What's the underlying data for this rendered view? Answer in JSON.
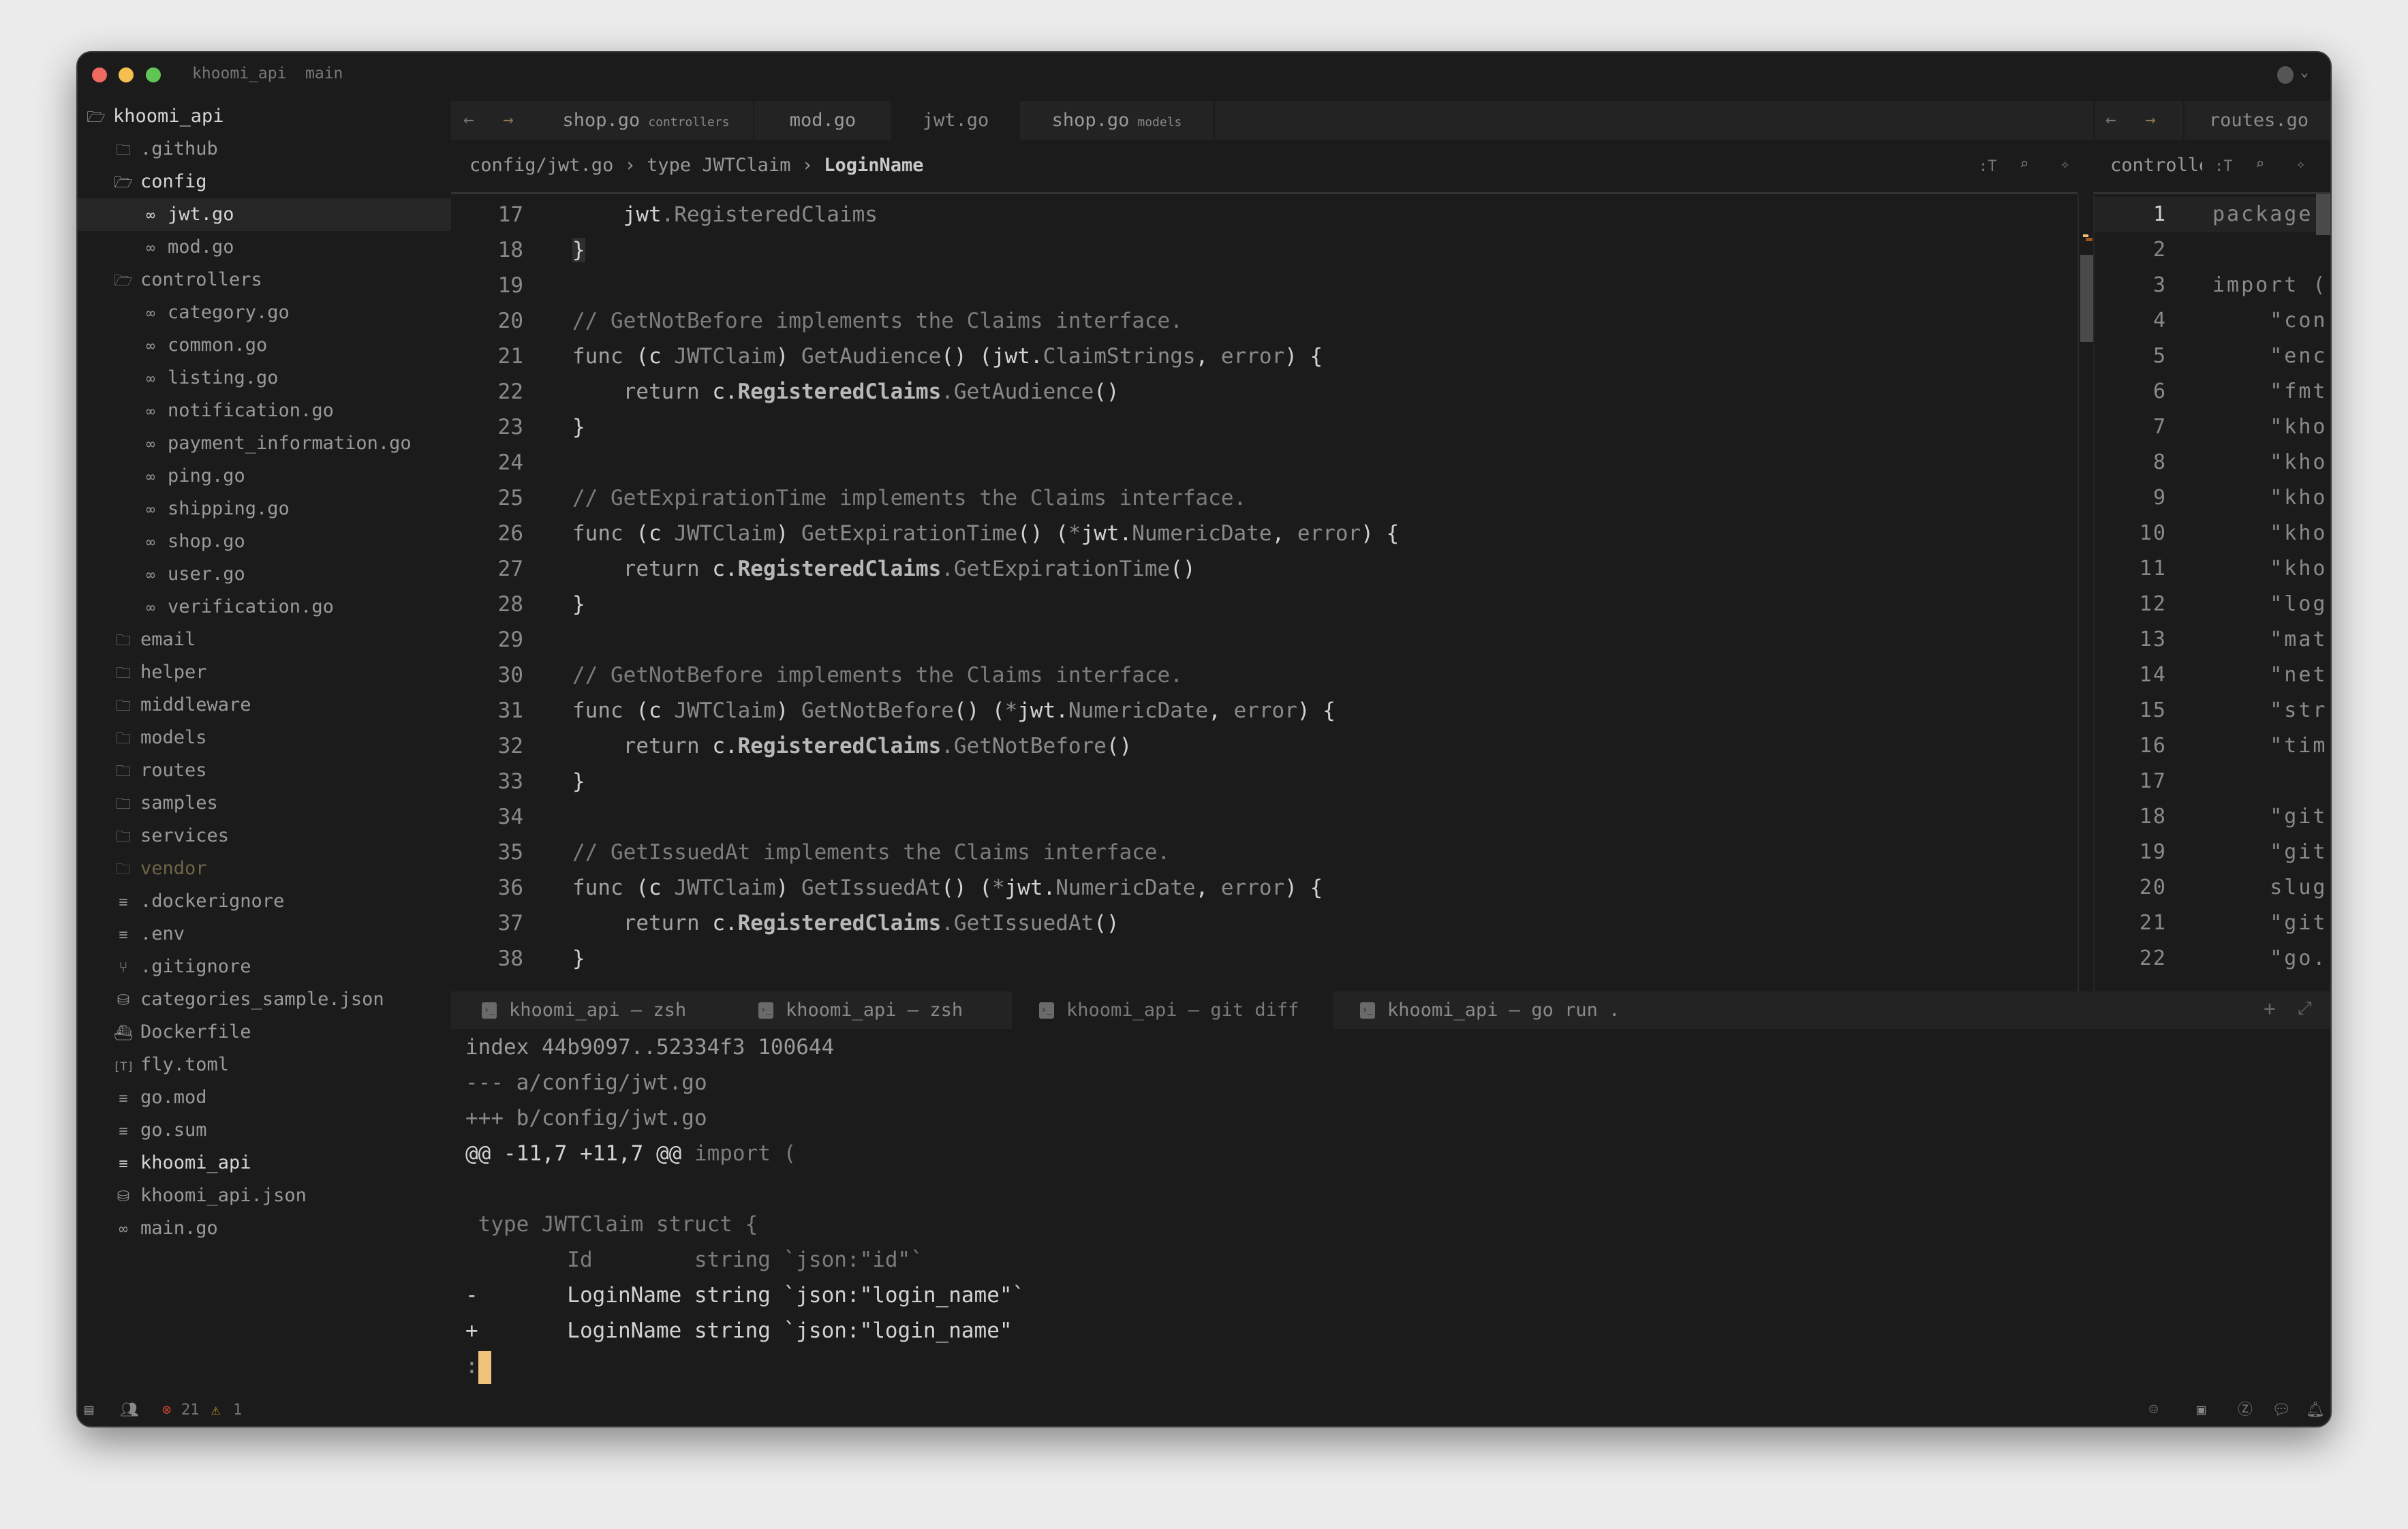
{
  "window": {
    "project": "khoomi_api",
    "branch": "main"
  },
  "colors": {
    "close": "#ed6a5e",
    "minimize": "#f5bf4f",
    "maximize": "#61c554",
    "cursor": "#f0c27b",
    "error": "#c4432f",
    "warning": "#c9962c",
    "vendor": "#6e6548"
  },
  "sidebar": {
    "items": [
      {
        "label": "khoomi_api",
        "icon": "folder-open-icon",
        "level": 0,
        "bright": true
      },
      {
        "label": ".github",
        "icon": "folder-icon",
        "level": 1
      },
      {
        "label": "config",
        "icon": "folder-open-icon",
        "level": 1,
        "bright": true
      },
      {
        "label": "jwt.go",
        "icon": "go-file-icon",
        "level": 2,
        "selected": true,
        "bright": true
      },
      {
        "label": "mod.go",
        "icon": "go-file-icon",
        "level": 2
      },
      {
        "label": "controllers",
        "icon": "folder-open-icon",
        "level": 1
      },
      {
        "label": "category.go",
        "icon": "go-file-icon",
        "level": 2
      },
      {
        "label": "common.go",
        "icon": "go-file-icon",
        "level": 2
      },
      {
        "label": "listing.go",
        "icon": "go-file-icon",
        "level": 2
      },
      {
        "label": "notification.go",
        "icon": "go-file-icon",
        "level": 2
      },
      {
        "label": "payment_information.go",
        "icon": "go-file-icon",
        "level": 2
      },
      {
        "label": "ping.go",
        "icon": "go-file-icon",
        "level": 2
      },
      {
        "label": "shipping.go",
        "icon": "go-file-icon",
        "level": 2
      },
      {
        "label": "shop.go",
        "icon": "go-file-icon",
        "level": 2
      },
      {
        "label": "user.go",
        "icon": "go-file-icon",
        "level": 2
      },
      {
        "label": "verification.go",
        "icon": "go-file-icon",
        "level": 2
      },
      {
        "label": "email",
        "icon": "folder-icon",
        "level": 1
      },
      {
        "label": "helper",
        "icon": "folder-icon",
        "level": 1
      },
      {
        "label": "middleware",
        "icon": "folder-icon",
        "level": 1
      },
      {
        "label": "models",
        "icon": "folder-icon",
        "level": 1
      },
      {
        "label": "routes",
        "icon": "folder-icon",
        "level": 1
      },
      {
        "label": "samples",
        "icon": "folder-icon",
        "level": 1
      },
      {
        "label": "services",
        "icon": "folder-icon",
        "level": 1
      },
      {
        "label": "vendor",
        "icon": "folder-icon",
        "level": 1,
        "ignored": true
      },
      {
        "label": ".dockerignore",
        "icon": "text-file-icon",
        "level": 1
      },
      {
        "label": ".env",
        "icon": "text-file-icon",
        "level": 1
      },
      {
        "label": ".gitignore",
        "icon": "git-icon",
        "level": 1
      },
      {
        "label": "categories_sample.json",
        "icon": "database-icon",
        "level": 1
      },
      {
        "label": "Dockerfile",
        "icon": "docker-icon",
        "level": 1
      },
      {
        "label": "fly.toml",
        "icon": "toml-icon",
        "level": 1
      },
      {
        "label": "go.mod",
        "icon": "text-file-icon",
        "level": 1
      },
      {
        "label": "go.sum",
        "icon": "text-file-icon",
        "level": 1
      },
      {
        "label": "khoomi_api",
        "icon": "text-file-icon",
        "level": 1,
        "bright": true
      },
      {
        "label": "khoomi_api.json",
        "icon": "database-icon",
        "level": 1
      },
      {
        "label": "main.go",
        "icon": "go-file-icon",
        "level": 1
      }
    ]
  },
  "editor": {
    "tabs": [
      {
        "label": "shop.go",
        "detail": "controllers"
      },
      {
        "label": "mod.go",
        "detail": ""
      },
      {
        "label": "jwt.go",
        "detail": "",
        "active": true
      },
      {
        "label": "shop.go",
        "detail": "models"
      }
    ],
    "breadcrumb": {
      "file": "config/jwt.go",
      "sep1": "›",
      "type": "type JWTClaim",
      "sep2": "›",
      "symbol": "LoginName"
    },
    "lines": [
      {
        "n": "17",
        "t": [
          [
            "    ",
            ""
          ],
          [
            "jwt",
            "fg"
          ],
          [
            ".RegisteredClaims",
            "dim"
          ]
        ]
      },
      {
        "n": "18",
        "t": [
          [
            "}",
            "fg br"
          ]
        ]
      },
      {
        "n": "19",
        "t": []
      },
      {
        "n": "20",
        "t": [
          [
            "// GetNotBefore implements the Claims interface.",
            "cm"
          ]
        ]
      },
      {
        "n": "21",
        "t": [
          [
            "func ",
            "kw"
          ],
          [
            "(c ",
            "fg"
          ],
          [
            "JWTClaim",
            "dim"
          ],
          [
            ") ",
            "fg"
          ],
          [
            "GetAudience",
            "dim"
          ],
          [
            "() (",
            "fg"
          ],
          [
            "jwt.",
            "fg"
          ],
          [
            "ClaimStrings",
            "dim"
          ],
          [
            ", ",
            "fg"
          ],
          [
            "error",
            "dim"
          ],
          [
            ") {",
            "fg"
          ]
        ]
      },
      {
        "n": "22",
        "t": [
          [
            "    return ",
            "kw"
          ],
          [
            "c.",
            "fg"
          ],
          [
            "RegisteredClaims",
            "bd"
          ],
          [
            ".GetAudience",
            "dim"
          ],
          [
            "()",
            "fg"
          ]
        ]
      },
      {
        "n": "23",
        "t": [
          [
            "}",
            "fg"
          ]
        ]
      },
      {
        "n": "24",
        "t": []
      },
      {
        "n": "25",
        "t": [
          [
            "// GetExpirationTime implements the Claims interface.",
            "cm"
          ]
        ]
      },
      {
        "n": "26",
        "t": [
          [
            "func ",
            "kw"
          ],
          [
            "(c ",
            "fg"
          ],
          [
            "JWTClaim",
            "dim"
          ],
          [
            ") ",
            "fg"
          ],
          [
            "GetExpirationTime",
            "dim"
          ],
          [
            "() (",
            "fg"
          ],
          [
            "*",
            "dim"
          ],
          [
            "jwt.",
            "fg"
          ],
          [
            "NumericDate",
            "dim"
          ],
          [
            ", ",
            "fg"
          ],
          [
            "error",
            "dim"
          ],
          [
            ") {",
            "fg"
          ]
        ]
      },
      {
        "n": "27",
        "t": [
          [
            "    return ",
            "kw"
          ],
          [
            "c.",
            "fg"
          ],
          [
            "RegisteredClaims",
            "bd"
          ],
          [
            ".GetExpirationTime",
            "dim"
          ],
          [
            "()",
            "fg"
          ]
        ]
      },
      {
        "n": "28",
        "t": [
          [
            "}",
            "fg"
          ]
        ]
      },
      {
        "n": "29",
        "t": []
      },
      {
        "n": "30",
        "t": [
          [
            "// GetNotBefore implements the Claims interface.",
            "cm"
          ]
        ]
      },
      {
        "n": "31",
        "t": [
          [
            "func ",
            "kw"
          ],
          [
            "(c ",
            "fg"
          ],
          [
            "JWTClaim",
            "dim"
          ],
          [
            ") ",
            "fg"
          ],
          [
            "GetNotBefore",
            "dim"
          ],
          [
            "() (",
            "fg"
          ],
          [
            "*",
            "dim"
          ],
          [
            "jwt.",
            "fg"
          ],
          [
            "NumericDate",
            "dim"
          ],
          [
            ", ",
            "fg"
          ],
          [
            "error",
            "dim"
          ],
          [
            ") {",
            "fg"
          ]
        ]
      },
      {
        "n": "32",
        "t": [
          [
            "    return ",
            "kw"
          ],
          [
            "c.",
            "fg"
          ],
          [
            "RegisteredClaims",
            "bd"
          ],
          [
            ".GetNotBefore",
            "dim"
          ],
          [
            "()",
            "fg"
          ]
        ]
      },
      {
        "n": "33",
        "t": [
          [
            "}",
            "fg"
          ]
        ]
      },
      {
        "n": "34",
        "t": []
      },
      {
        "n": "35",
        "t": [
          [
            "// GetIssuedAt implements the Claims interface.",
            "cm"
          ]
        ]
      },
      {
        "n": "36",
        "t": [
          [
            "func ",
            "kw"
          ],
          [
            "(c ",
            "fg"
          ],
          [
            "JWTClaim",
            "dim"
          ],
          [
            ") ",
            "fg"
          ],
          [
            "GetIssuedAt",
            "dim"
          ],
          [
            "() (",
            "fg"
          ],
          [
            "*",
            "dim"
          ],
          [
            "jwt.",
            "fg"
          ],
          [
            "NumericDate",
            "dim"
          ],
          [
            ", ",
            "fg"
          ],
          [
            "error",
            "dim"
          ],
          [
            ") {",
            "fg"
          ]
        ]
      },
      {
        "n": "37",
        "t": [
          [
            "    return ",
            "kw"
          ],
          [
            "c.",
            "fg"
          ],
          [
            "RegisteredClaims",
            "bd"
          ],
          [
            ".GetIssuedAt",
            "dim"
          ],
          [
            "()",
            "fg"
          ]
        ]
      },
      {
        "n": "38",
        "t": [
          [
            "}",
            "fg"
          ]
        ]
      }
    ]
  },
  "right_pane": {
    "tab": "routes.go",
    "breadcrumb": "controlle",
    "lines": [
      {
        "n": "1",
        "text": "package"
      },
      {
        "n": "2",
        "text": ""
      },
      {
        "n": "3",
        "text": "import ("
      },
      {
        "n": "4",
        "text": "    \"con"
      },
      {
        "n": "5",
        "text": "    \"enc"
      },
      {
        "n": "6",
        "text": "    \"fmt"
      },
      {
        "n": "7",
        "text": "    \"kho"
      },
      {
        "n": "8",
        "text": "    \"kho"
      },
      {
        "n": "9",
        "text": "    \"kho"
      },
      {
        "n": "10",
        "text": "    \"kho"
      },
      {
        "n": "11",
        "text": "    \"kho"
      },
      {
        "n": "12",
        "text": "    \"log"
      },
      {
        "n": "13",
        "text": "    \"mat"
      },
      {
        "n": "14",
        "text": "    \"net"
      },
      {
        "n": "15",
        "text": "    \"str"
      },
      {
        "n": "16",
        "text": "    \"tim"
      },
      {
        "n": "17",
        "text": ""
      },
      {
        "n": "18",
        "text": "    \"git"
      },
      {
        "n": "19",
        "text": "    \"git"
      },
      {
        "n": "20",
        "text": "    slug"
      },
      {
        "n": "21",
        "text": "    \"git"
      },
      {
        "n": "22",
        "text": "    \"go."
      }
    ]
  },
  "terminal": {
    "tabs": [
      {
        "label": "khoomi_api — zsh"
      },
      {
        "label": "khoomi_api — zsh"
      },
      {
        "label": "khoomi_api — git diff",
        "active": true
      },
      {
        "label": "khoomi_api — go run ."
      }
    ],
    "lines": [
      [
        [
          "index 44b9097..52334f3 100644",
          "dim bd2"
        ]
      ],
      [
        [
          "--- a/config/jwt.go",
          "dim"
        ]
      ],
      [
        [
          "+++ b/config/jwt.go",
          "dim"
        ]
      ],
      [
        [
          "@@ -11,7 +11,7 @@",
          "fg"
        ],
        [
          " import (",
          "cm"
        ]
      ],
      [],
      [
        [
          " type JWTClaim struct {",
          "cm"
        ]
      ],
      [
        [
          "        Id        string `json:\"id\"`",
          "cm"
        ]
      ],
      [
        [
          "-       LoginName string `json:\"login_name\"`",
          "fg"
        ]
      ],
      [
        [
          "+       LoginName string `json:\"login_name\"",
          "fg"
        ]
      ]
    ],
    "prompt": ":"
  },
  "status": {
    "errors": "21",
    "warnings": "1"
  }
}
